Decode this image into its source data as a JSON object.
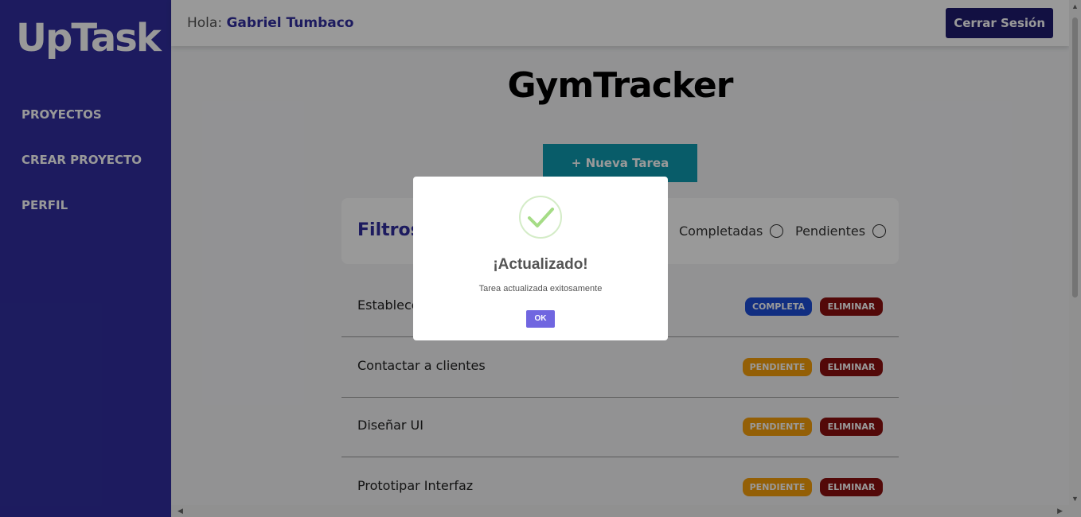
{
  "sidebar": {
    "logo": "UpTask",
    "items": [
      {
        "label": "PROYECTOS"
      },
      {
        "label": "CREAR PROYECTO"
      },
      {
        "label": "PERFIL"
      }
    ]
  },
  "header": {
    "greeting_prefix": "Hola:",
    "user_name": "Gabriel Tumbaco",
    "logout_label": "Cerrar Sesión"
  },
  "main": {
    "project_name": "GymTracker",
    "new_task_label": "+ Nueva Tarea",
    "filters": {
      "title": "Filtros",
      "options": [
        {
          "label": "Completadas",
          "checked": false
        },
        {
          "label": "Pendientes",
          "checked": false
        }
      ]
    },
    "tasks": [
      {
        "name": "Establece",
        "status_label": "COMPLETA",
        "delete_label": "ELIMINAR"
      },
      {
        "name": "Contactar a clientes",
        "status_label": "PENDIENTE",
        "delete_label": "ELIMINAR"
      },
      {
        "name": "Diseñar UI",
        "status_label": "PENDIENTE",
        "delete_label": "ELIMINAR"
      },
      {
        "name": "Prototipar Interfaz",
        "status_label": "PENDIENTE",
        "delete_label": "ELIMINAR"
      }
    ]
  },
  "modal": {
    "icon": "success-check-icon",
    "title": "¡Actualizado!",
    "message": "Tarea actualizada exitosamente",
    "confirm_label": "OK"
  },
  "colors": {
    "sidebar": "#312e9e",
    "accent_cyan": "#0e9ab0",
    "complete": "#1d4ed8",
    "pending": "#f59e0b",
    "delete": "#8b0f0f",
    "confirm": "#7066e0"
  }
}
